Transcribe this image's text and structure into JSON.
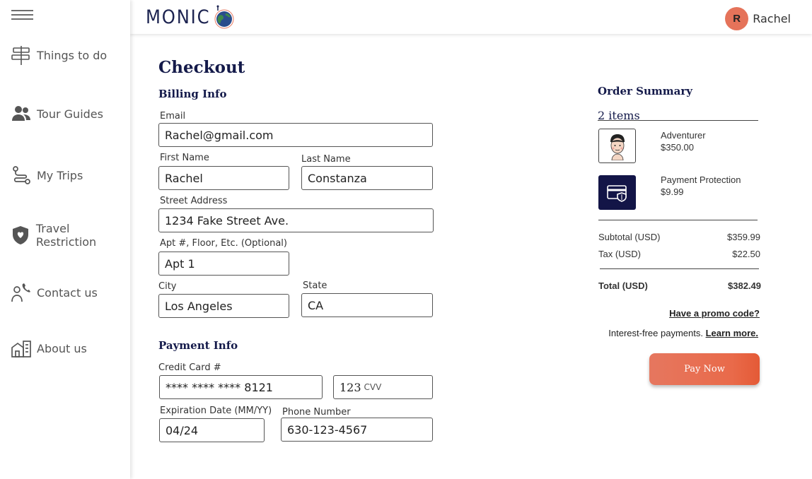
{
  "sidebar": {
    "items": [
      {
        "label": "Things to do",
        "icon": "signpost-icon"
      },
      {
        "label": "Tour Guides",
        "icon": "people-icon"
      },
      {
        "label": "My Trips",
        "icon": "route-icon"
      },
      {
        "label": "Travel Restriction",
        "icon": "shield-heart-icon"
      },
      {
        "label": "Contact us",
        "icon": "person-phone-icon"
      },
      {
        "label": "About us",
        "icon": "buildings-icon"
      }
    ]
  },
  "header": {
    "logo_text": "MONIC",
    "user_initial": "R",
    "user_name": "Rachel"
  },
  "checkout": {
    "title": "Checkout",
    "billing_title": "Billing Info",
    "email_label": "Email",
    "email_value": "Rachel@gmail.com",
    "first_name_label": "First Name",
    "first_name_value": "Rachel",
    "last_name_label": "Last Name",
    "last_name_value": "Constanza",
    "street_label": "Street Address",
    "street_value": "1234 Fake Street Ave.",
    "apt_label": "Apt #, Floor, Etc. (Optional)",
    "apt_value": "Apt 1",
    "city_label": "City",
    "city_value": "Los Angeles",
    "state_label": "State",
    "state_value": "CA",
    "payment_title": "Payment Info",
    "card_label": "Credit Card #",
    "card_value": "**** **** **** 8121",
    "cvv_value": "123",
    "cvv_suffix": "CVV",
    "exp_label": "Expiration Date (MM/YY)",
    "exp_value": "04/24",
    "phone_label": "Phone Number",
    "phone_value": "630-123-4567"
  },
  "summary": {
    "title": "Order Summary",
    "items_count": "2 items",
    "items": [
      {
        "name": "Adventurer",
        "price": "$350.00"
      },
      {
        "name": "Payment Protection",
        "price": "$9.99"
      }
    ],
    "subtotal_label": "Subtotal (USD)",
    "subtotal_value": "$359.99",
    "tax_label": "Tax (USD)",
    "tax_value": "$22.50",
    "total_label": "Total (USD)",
    "total_value": "$382.49",
    "promo_link": "Have a promo code?",
    "interest_text": "Interest-free payments.",
    "learn_more": "Learn more.",
    "pay_button": "Pay Now"
  },
  "colors": {
    "navy": "#141a4a",
    "accent": "#e96a4a",
    "avatar": "#e5735a"
  }
}
